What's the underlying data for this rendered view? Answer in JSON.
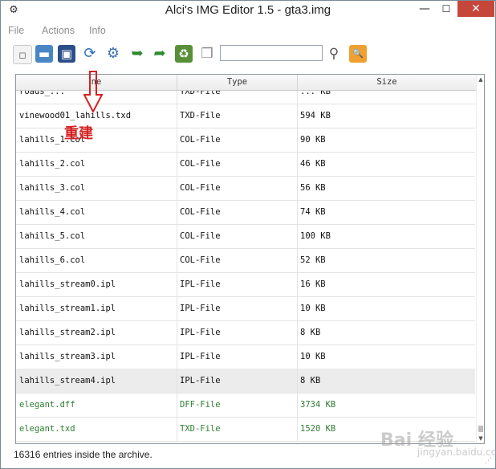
{
  "window": {
    "title": "Alci's IMG Editor 1.5 - gta3.img",
    "app_icon": "gear-app-icon",
    "controls": {
      "minimize": "—",
      "maximize": "☐",
      "close": "✕"
    }
  },
  "menubar": {
    "items": [
      "File",
      "Actions",
      "Info"
    ]
  },
  "toolbar": {
    "buttons": [
      {
        "name": "new-icon",
        "glyph": "▫"
      },
      {
        "name": "open-folder-icon",
        "glyph": "▬"
      },
      {
        "name": "save-disk-icon",
        "glyph": "▣"
      },
      {
        "name": "refresh-icon",
        "glyph": "⟳"
      },
      {
        "name": "settings-gear-icon",
        "glyph": "⚙"
      },
      {
        "name": "import-arrow-icon",
        "glyph": "➥"
      },
      {
        "name": "export-arrow-icon",
        "glyph": "➦"
      },
      {
        "name": "rebuild-recycle-icon",
        "glyph": "♻"
      },
      {
        "name": "copy-icon",
        "glyph": "❐"
      }
    ],
    "search_value": "",
    "search_glyph": "⚲",
    "find_folder_glyph": "🔍"
  },
  "list": {
    "columns": [
      "Name",
      "Type",
      "Size"
    ],
    "column_header_visible": [
      "ne",
      "Type",
      "Size"
    ],
    "rows": [
      {
        "name": "roads_...",
        "type": "TXD-File",
        "size": "... KB"
      },
      {
        "name": "vinewood01_lahills.txd",
        "type": "TXD-File",
        "size": "594 KB"
      },
      {
        "name": "lahills_1.col",
        "type": "COL-File",
        "size": "90 KB"
      },
      {
        "name": "lahills_2.col",
        "type": "COL-File",
        "size": "46 KB"
      },
      {
        "name": "lahills_3.col",
        "type": "COL-File",
        "size": "56 KB"
      },
      {
        "name": "lahills_4.col",
        "type": "COL-File",
        "size": "74 KB"
      },
      {
        "name": "lahills_5.col",
        "type": "COL-File",
        "size": "100 KB"
      },
      {
        "name": "lahills_6.col",
        "type": "COL-File",
        "size": "52 KB"
      },
      {
        "name": "lahills_stream0.ipl",
        "type": "IPL-File",
        "size": "16 KB"
      },
      {
        "name": "lahills_stream1.ipl",
        "type": "IPL-File",
        "size": "10 KB"
      },
      {
        "name": "lahills_stream2.ipl",
        "type": "IPL-File",
        "size": "8 KB"
      },
      {
        "name": "lahills_stream3.ipl",
        "type": "IPL-File",
        "size": "10 KB"
      },
      {
        "name": "lahills_stream4.ipl",
        "type": "IPL-File",
        "size": "8 KB",
        "selected": true
      },
      {
        "name": "elegant.dff",
        "type": "DFF-File",
        "size": "3734 KB",
        "color": "#2e7d32"
      },
      {
        "name": "elegant.txd",
        "type": "TXD-File",
        "size": "1520 KB",
        "color": "#2e7d32"
      }
    ]
  },
  "status": {
    "text": "16316 entries inside the archive."
  },
  "annotation": {
    "label": "重建",
    "color": "#d62121"
  },
  "watermark": {
    "text": "Bai 经验",
    "sub": "jingyan.baidu.com"
  },
  "colors": {
    "accent_close": "#c7463a",
    "new_entry_green": "#2e7d32",
    "annotation_red": "#d62121"
  }
}
